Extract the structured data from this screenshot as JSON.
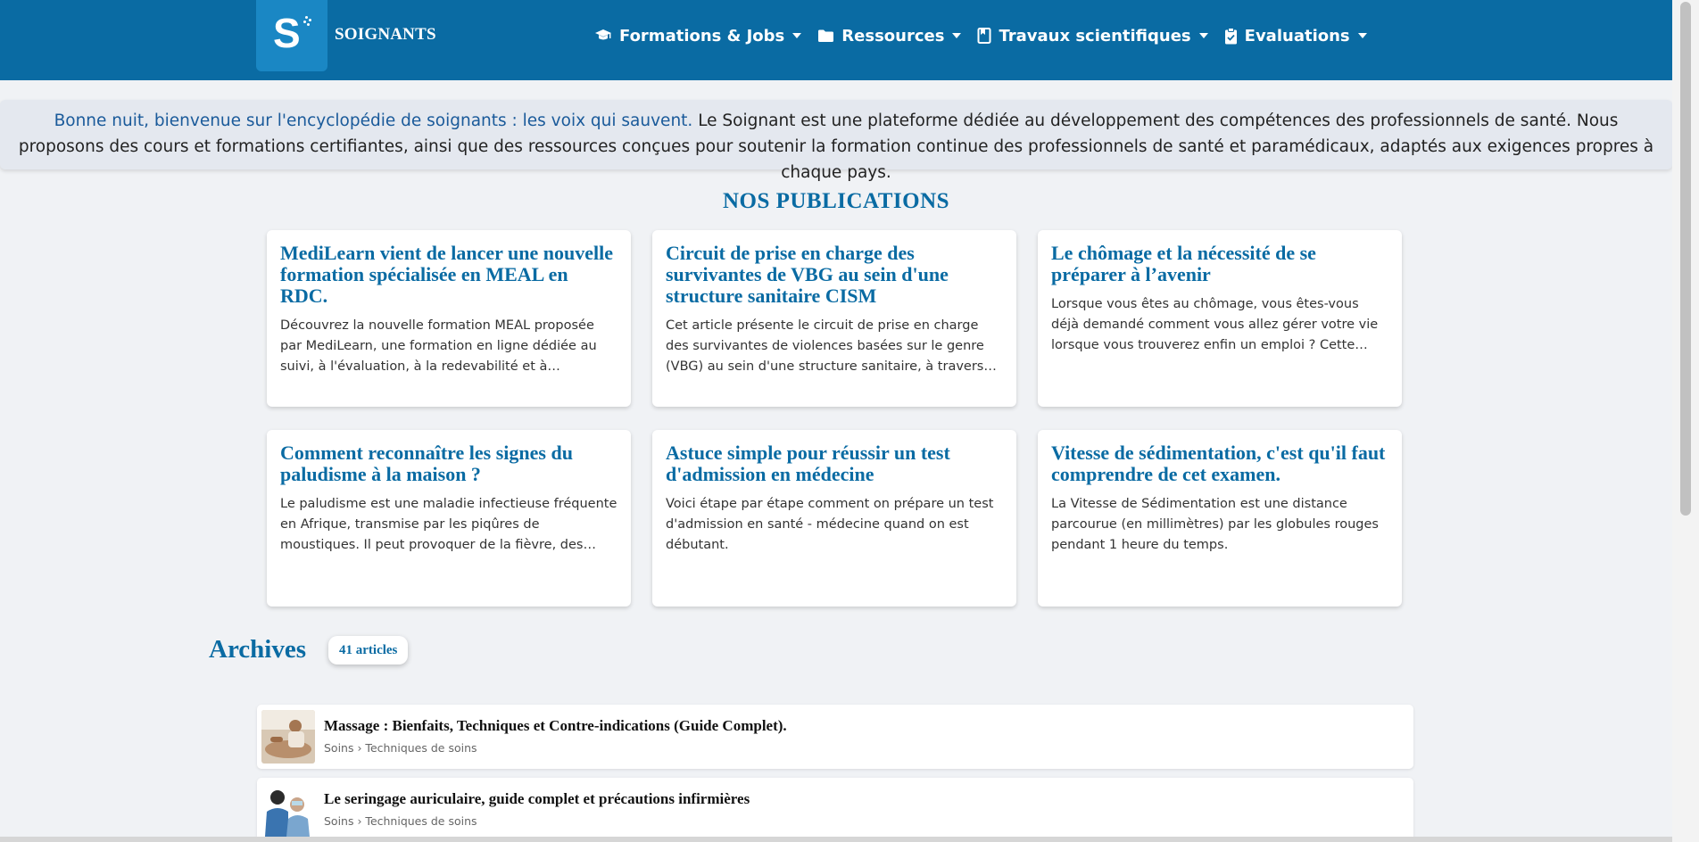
{
  "header": {
    "logo_letter": "S",
    "brand": "SOIGNANTS",
    "nav": [
      {
        "label": "Formations & Jobs",
        "icon": "graduation-cap-icon"
      },
      {
        "label": "Ressources",
        "icon": "folder-icon"
      },
      {
        "label": "Travaux scientifiques",
        "icon": "book-icon"
      },
      {
        "label": "Evaluations",
        "icon": "clipboard-icon"
      }
    ]
  },
  "welcome": {
    "greeting": "Bonne nuit, bienvenue sur l'encyclopédie de soignants : les voix qui sauvent.",
    "text": " Le Soignant est une plateforme dédiée au développement des compétences des professionnels de santé. Nous proposons des cours et formations certifiantes, ainsi que des ressources conçues pour soutenir la formation continue des professionnels de santé et paramédicaux, adaptés aux exigences propres à chaque pays."
  },
  "publications": {
    "title": "NOS PUBLICATIONS",
    "cards": [
      {
        "title": "MediLearn vient de lancer une nouvelle formation spécialisée en MEAL en RDC.",
        "desc": "Découvrez la nouvelle formation MEAL proposée par MediLearn, une formation en ligne dédiée au suivi, à l'évaluation, à la redevabilité et à l'apprentissage."
      },
      {
        "title": "Circuit de prise en charge des survivantes de VBG au sein d'une structure sanitaire CISM",
        "desc": "Cet article présente le circuit de prise en charge des survivantes de violences basées sur le genre (VBG) au sein d'une structure sanitaire, à travers un CISM"
      },
      {
        "title": "Le chômage et la nécessité de se préparer à l’avenir",
        "desc": "Lorsque vous êtes au chômage, vous êtes-vous déjà demandé comment vous allez gérer votre vie lorsque vous trouverez enfin un emploi ? Cette question mérite réflexion."
      },
      {
        "title": "Comment reconnaître les signes du paludisme à la maison ?",
        "desc": "Le paludisme est une maladie infectieuse fréquente en Afrique, transmise par les piqûres de moustiques. Il peut provoquer de la fièvre, des frissons, des maux de tête."
      },
      {
        "title": "Astuce simple pour réussir un test d'admission en médecine",
        "desc": "Voici étape par étape comment on prépare un test d'admission en santé - médecine quand on est débutant."
      },
      {
        "title": "Vitesse de sédimentation, c'est qu'il faut comprendre de cet examen.",
        "desc": "La Vitesse de Sédimentation est une distance parcourue (en millimètres) par les globules rouges pendant 1 heure du temps."
      }
    ]
  },
  "archives": {
    "title": "Archives",
    "count": "41 articles",
    "items": [
      {
        "title": "Massage : Bienfaits, Techniques et Contre-indications (Guide Complet).",
        "crumb": "Soins › Techniques de soins"
      },
      {
        "title": "Le seringage auriculaire, guide complet et précautions infirmières",
        "crumb": "Soins › Techniques de soins"
      }
    ]
  },
  "colors": {
    "primary": "#0a6ba3",
    "logo_bg": "#1a87c4",
    "page_bg": "#f0f2f5",
    "greeting": "#1a5a9a"
  }
}
